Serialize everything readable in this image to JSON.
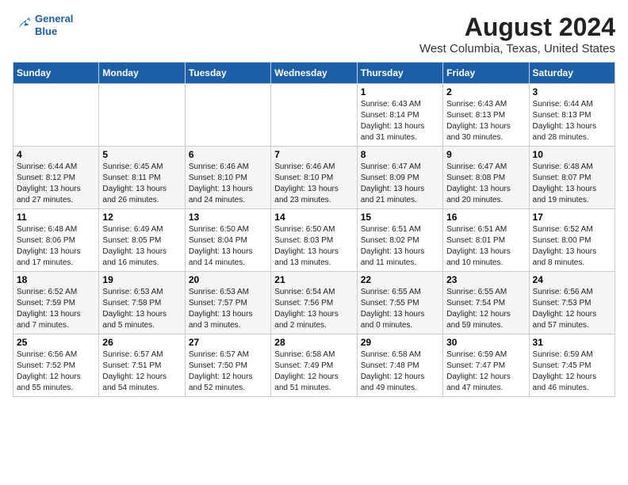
{
  "header": {
    "logo_line1": "General",
    "logo_line2": "Blue",
    "title": "August 2024",
    "subtitle": "West Columbia, Texas, United States"
  },
  "days_of_week": [
    "Sunday",
    "Monday",
    "Tuesday",
    "Wednesday",
    "Thursday",
    "Friday",
    "Saturday"
  ],
  "weeks": [
    [
      {
        "day": "",
        "info": ""
      },
      {
        "day": "",
        "info": ""
      },
      {
        "day": "",
        "info": ""
      },
      {
        "day": "",
        "info": ""
      },
      {
        "day": "1",
        "info": "Sunrise: 6:43 AM\nSunset: 8:14 PM\nDaylight: 13 hours\nand 31 minutes."
      },
      {
        "day": "2",
        "info": "Sunrise: 6:43 AM\nSunset: 8:13 PM\nDaylight: 13 hours\nand 30 minutes."
      },
      {
        "day": "3",
        "info": "Sunrise: 6:44 AM\nSunset: 8:13 PM\nDaylight: 13 hours\nand 28 minutes."
      }
    ],
    [
      {
        "day": "4",
        "info": "Sunrise: 6:44 AM\nSunset: 8:12 PM\nDaylight: 13 hours\nand 27 minutes."
      },
      {
        "day": "5",
        "info": "Sunrise: 6:45 AM\nSunset: 8:11 PM\nDaylight: 13 hours\nand 26 minutes."
      },
      {
        "day": "6",
        "info": "Sunrise: 6:46 AM\nSunset: 8:10 PM\nDaylight: 13 hours\nand 24 minutes."
      },
      {
        "day": "7",
        "info": "Sunrise: 6:46 AM\nSunset: 8:10 PM\nDaylight: 13 hours\nand 23 minutes."
      },
      {
        "day": "8",
        "info": "Sunrise: 6:47 AM\nSunset: 8:09 PM\nDaylight: 13 hours\nand 21 minutes."
      },
      {
        "day": "9",
        "info": "Sunrise: 6:47 AM\nSunset: 8:08 PM\nDaylight: 13 hours\nand 20 minutes."
      },
      {
        "day": "10",
        "info": "Sunrise: 6:48 AM\nSunset: 8:07 PM\nDaylight: 13 hours\nand 19 minutes."
      }
    ],
    [
      {
        "day": "11",
        "info": "Sunrise: 6:48 AM\nSunset: 8:06 PM\nDaylight: 13 hours\nand 17 minutes."
      },
      {
        "day": "12",
        "info": "Sunrise: 6:49 AM\nSunset: 8:05 PM\nDaylight: 13 hours\nand 16 minutes."
      },
      {
        "day": "13",
        "info": "Sunrise: 6:50 AM\nSunset: 8:04 PM\nDaylight: 13 hours\nand 14 minutes."
      },
      {
        "day": "14",
        "info": "Sunrise: 6:50 AM\nSunset: 8:03 PM\nDaylight: 13 hours\nand 13 minutes."
      },
      {
        "day": "15",
        "info": "Sunrise: 6:51 AM\nSunset: 8:02 PM\nDaylight: 13 hours\nand 11 minutes."
      },
      {
        "day": "16",
        "info": "Sunrise: 6:51 AM\nSunset: 8:01 PM\nDaylight: 13 hours\nand 10 minutes."
      },
      {
        "day": "17",
        "info": "Sunrise: 6:52 AM\nSunset: 8:00 PM\nDaylight: 13 hours\nand 8 minutes."
      }
    ],
    [
      {
        "day": "18",
        "info": "Sunrise: 6:52 AM\nSunset: 7:59 PM\nDaylight: 13 hours\nand 7 minutes."
      },
      {
        "day": "19",
        "info": "Sunrise: 6:53 AM\nSunset: 7:58 PM\nDaylight: 13 hours\nand 5 minutes."
      },
      {
        "day": "20",
        "info": "Sunrise: 6:53 AM\nSunset: 7:57 PM\nDaylight: 13 hours\nand 3 minutes."
      },
      {
        "day": "21",
        "info": "Sunrise: 6:54 AM\nSunset: 7:56 PM\nDaylight: 13 hours\nand 2 minutes."
      },
      {
        "day": "22",
        "info": "Sunrise: 6:55 AM\nSunset: 7:55 PM\nDaylight: 13 hours\nand 0 minutes."
      },
      {
        "day": "23",
        "info": "Sunrise: 6:55 AM\nSunset: 7:54 PM\nDaylight: 12 hours\nand 59 minutes."
      },
      {
        "day": "24",
        "info": "Sunrise: 6:56 AM\nSunset: 7:53 PM\nDaylight: 12 hours\nand 57 minutes."
      }
    ],
    [
      {
        "day": "25",
        "info": "Sunrise: 6:56 AM\nSunset: 7:52 PM\nDaylight: 12 hours\nand 55 minutes."
      },
      {
        "day": "26",
        "info": "Sunrise: 6:57 AM\nSunset: 7:51 PM\nDaylight: 12 hours\nand 54 minutes."
      },
      {
        "day": "27",
        "info": "Sunrise: 6:57 AM\nSunset: 7:50 PM\nDaylight: 12 hours\nand 52 minutes."
      },
      {
        "day": "28",
        "info": "Sunrise: 6:58 AM\nSunset: 7:49 PM\nDaylight: 12 hours\nand 51 minutes."
      },
      {
        "day": "29",
        "info": "Sunrise: 6:58 AM\nSunset: 7:48 PM\nDaylight: 12 hours\nand 49 minutes."
      },
      {
        "day": "30",
        "info": "Sunrise: 6:59 AM\nSunset: 7:47 PM\nDaylight: 12 hours\nand 47 minutes."
      },
      {
        "day": "31",
        "info": "Sunrise: 6:59 AM\nSunset: 7:45 PM\nDaylight: 12 hours\nand 46 minutes."
      }
    ]
  ]
}
